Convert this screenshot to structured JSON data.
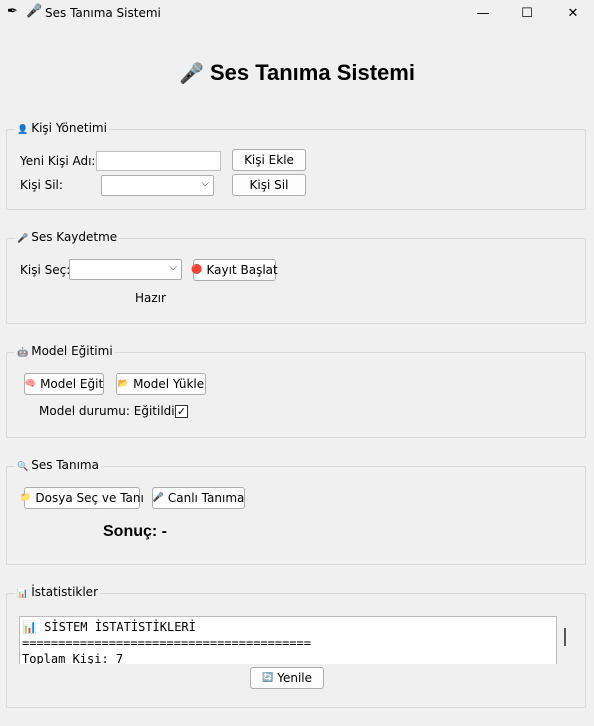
{
  "window": {
    "title": "Ses Tanıma Sistemi",
    "controls": {
      "minimize": "—",
      "maximize": "☐",
      "close": "✕"
    }
  },
  "heading": {
    "icon": "🎤",
    "title": "Ses Tanıma Sistemi"
  },
  "person_mgmt": {
    "legend": "Kişi Yönetimi",
    "new_label": "Yeni Kişi Adı:",
    "new_value": "",
    "add_button": "Kişi Ekle",
    "delete_label": "Kişi Sil:",
    "delete_selected": "",
    "delete_button": "Kişi Sil"
  },
  "recording": {
    "legend": "Ses Kaydetme",
    "select_label": "Kişi Seç:",
    "select_selected": "",
    "record_button": "Kayıt Başlat",
    "status": "Hazır"
  },
  "training": {
    "legend": "Model Eğitimi",
    "train_button": "Model Eğit",
    "load_button": "Model Yükle",
    "status_label": "Model durumu: Eğitildi",
    "checked": true
  },
  "recognition": {
    "legend": "Ses Tanıma",
    "file_button": "Dosya Seç ve Tanı",
    "live_button": "Canlı Tanıma",
    "result": "Sonuç: -"
  },
  "stats": {
    "legend": "İstatistikler",
    "lines": [
      "📊 SİSTEM İSTATİSTİKLERİ",
      "========================================",
      "Toplam Kişi: 7"
    ],
    "refresh_button": "Yenile"
  }
}
